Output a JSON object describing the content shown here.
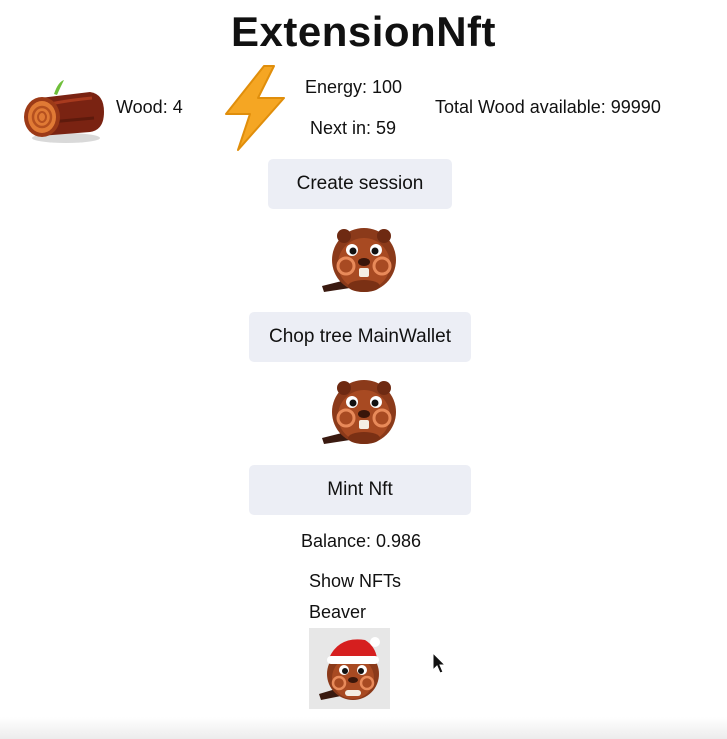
{
  "app": {
    "title": "ExtensionNft"
  },
  "stats": {
    "wood_label": "Wood: 4",
    "energy_label": "Energy: 100",
    "next_in_label": "Next in: 59",
    "total_wood_label": "Total Wood available: 99990"
  },
  "buttons": {
    "create_session": "Create session",
    "chop_tree": "Chop tree MainWallet",
    "mint_nft": "Mint Nft"
  },
  "wallet": {
    "balance_label": "Balance: 0.986"
  },
  "nfts": {
    "show_label": "Show NFTs",
    "items": [
      {
        "name": "Beaver"
      }
    ]
  },
  "icons": {
    "log": "wood-log-icon",
    "energy": "lightning-bolt-icon",
    "beaver": "beaver-icon",
    "nft_beaver": "santa-beaver-icon"
  },
  "colors": {
    "button_bg": "#eceef5",
    "bolt": "#f5a623",
    "beaver_brown": "#8b3a1a"
  }
}
